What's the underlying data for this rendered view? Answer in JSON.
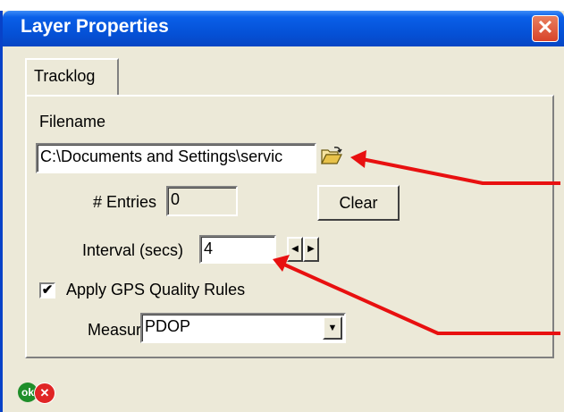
{
  "window": {
    "title": "Layer Properties",
    "close_glyph": "✕"
  },
  "tabs": [
    {
      "label": "Tracklog",
      "active": true
    }
  ],
  "form": {
    "filename_label": "Filename",
    "filename_value": "C:\\Documents and Settings\\servic",
    "browse_icon": "open-folder-icon",
    "entries_label": "# Entries",
    "entries_value": "0",
    "clear_button": "Clear",
    "interval_label": "Interval (secs)",
    "interval_value": "4",
    "spin_left": "◀",
    "spin_right": "▶",
    "gps_rules_checked": true,
    "gps_rules_label": "Apply GPS Quality Rules",
    "check_glyph": "✔",
    "measure_label": "Measure",
    "measure_value": "PDOP",
    "dropdown_glyph": "▼"
  },
  "footer": {
    "ok_label": "ok",
    "cancel_glyph": "✕"
  },
  "colors": {
    "title_bar": "#0552d8",
    "window_bg": "#ece9d8",
    "annotation_arrow": "#e81010"
  }
}
